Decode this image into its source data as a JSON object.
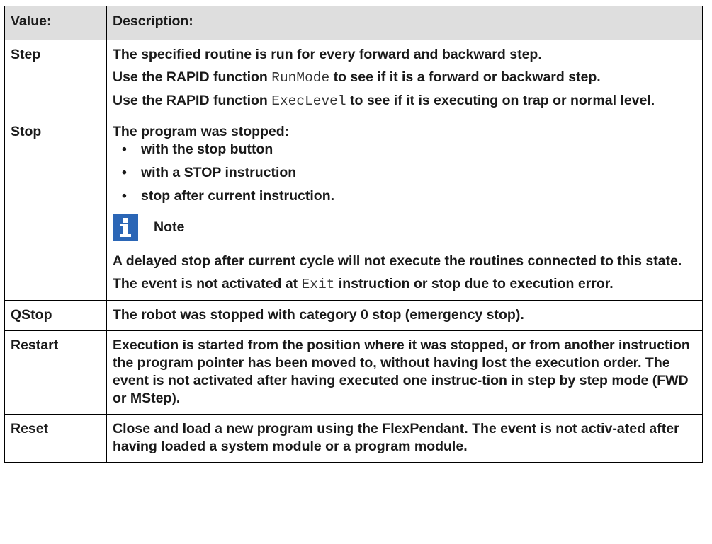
{
  "headers": {
    "value": "Value:",
    "description": "Description:"
  },
  "rows": {
    "step": {
      "value": "Step",
      "p1": "The specified routine is run for every forward and backward step.",
      "p2_pre": "Use the RAPID function ",
      "p2_code": "RunMode",
      "p2_post": " to see if it is a forward or backward step.",
      "p3_pre": "Use the RAPID function ",
      "p3_code": "ExecLevel",
      "p3_post": " to see if it is executing on trap or normal level."
    },
    "stop": {
      "value": "Stop",
      "intro": "The program was stopped:",
      "bullets": [
        "with the stop button",
        "with a STOP instruction",
        "stop after current instruction."
      ],
      "note_label": "Note",
      "p1": "A delayed stop after current cycle will not execute the routines connected to this state.",
      "p2_pre": "The event is not activated at ",
      "p2_code": "Exit",
      "p2_post": " instruction or stop due to execution error."
    },
    "qstop": {
      "value": "QStop",
      "p1": "The robot was stopped with category 0 stop (emergency stop)."
    },
    "restart": {
      "value": "Restart",
      "p1": "Execution is started from the position where it was stopped, or from another instruction the program pointer has been moved to, without having lost the execution order. The event is not activated after having executed one instruc-tion in step by step mode (FWD or MStep)."
    },
    "reset": {
      "value": "Reset",
      "p1": "Close and load a new program using the FlexPendant. The event is not activ-ated after having loaded a system module or a program module."
    }
  },
  "icons": {
    "note": "info-icon",
    "note_color": "#2b66b6"
  }
}
